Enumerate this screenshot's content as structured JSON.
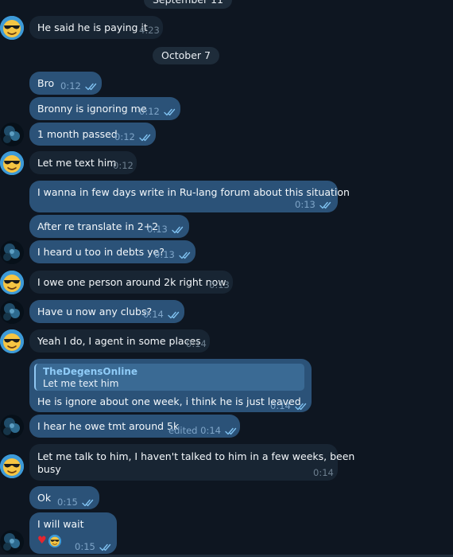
{
  "colors": {
    "background": "#0e1621",
    "outgoing_bubble": "#2b5278",
    "incoming_bubble": "#182533",
    "date_pill": "#1e2c3a",
    "read_ticks": "#7fc1f0",
    "reply_accent": "#8fcbf7",
    "reaction_heart": "#e5262f"
  },
  "date_separators": [
    "September 11",
    "October 7"
  ],
  "avatars": {
    "emoji_user": "sunglasses-emoji-avatar",
    "dark_user": "dark-blue-avatar"
  },
  "messages": [
    {
      "text": "He said he is paying it",
      "time": "4:23"
    },
    {
      "text": "Bro",
      "time": "0:12"
    },
    {
      "text": "Bronny is ignoring me",
      "time": "0:12"
    },
    {
      "text": "1 month passed",
      "time": "0:12"
    },
    {
      "text": "Let me text him",
      "time": "0:12"
    },
    {
      "text": "I wanna in few days write in Ru-lang forum about this situation",
      "time": "0:13"
    },
    {
      "text": "After re translate in 2+2",
      "time": "0:13"
    },
    {
      "text": "I heard u too in debts ye?",
      "time": "0:13"
    },
    {
      "text": "I owe one person around 2k right now",
      "time": "0:13"
    },
    {
      "text": "Have u now any clubs?",
      "time": "0:14"
    },
    {
      "text": "Yeah I do, I agent in some places",
      "time": "0:14"
    },
    {
      "reply_to_name": "TheDegensOnline",
      "reply_to_text": "Let me text him",
      "text": "He is ignore about one week, i think he is just leaved",
      "time": "0:14"
    },
    {
      "text": "I hear he owe tmt around 5k",
      "edited": "edited",
      "time": "0:14"
    },
    {
      "text_line1": "Let me talk to him, I haven't talked to him in a few weeks, been",
      "text_line2": "busy",
      "time": "0:14"
    },
    {
      "text": "Ok",
      "time": "0:15"
    },
    {
      "text": "I will wait",
      "time": "0:15",
      "reactions": [
        "red-heart",
        "sunglasses-emoji-avatar"
      ]
    }
  ]
}
